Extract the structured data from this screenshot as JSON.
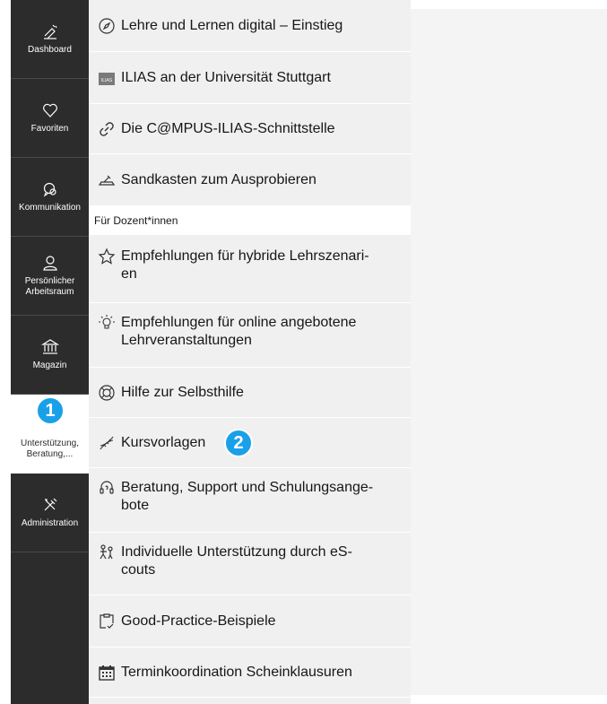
{
  "mainbar": {
    "items": [
      {
        "label": "Dashboard",
        "icon": "dashboard-icon"
      },
      {
        "label": "Favoriten",
        "icon": "heart-icon"
      },
      {
        "label": "Kommunikation",
        "icon": "chat-icon"
      },
      {
        "label": "Persönlicher Arbeitsraum",
        "icon": "person-icon"
      },
      {
        "label": "Magazin",
        "icon": "repository-icon"
      },
      {
        "label": "Unterstützung, Beratung,...",
        "icon": "none"
      },
      {
        "label": "Administration",
        "icon": "tools-icon"
      }
    ]
  },
  "slate": {
    "entries": [
      {
        "label": "Lehre und Lernen digital – Einstieg",
        "icon": "compass-icon"
      },
      {
        "label": "ILIAS an der Universität Stuttgart",
        "icon": "ilias-logo-icon"
      },
      {
        "label": "Die C@MPUS-ILIAS-Schnittstelle",
        "icon": "link-icon"
      },
      {
        "label": "Sandkasten zum Ausprobieren",
        "icon": "sandbox-icon"
      }
    ],
    "section_title": "Für Dozent*innen",
    "section_entries": [
      {
        "label_line1": "Empfehlungen für hybride Lehrszenari-",
        "label_line2": "en",
        "icon": "star-icon"
      },
      {
        "label_line1": "Empfehlungen für online angebotene",
        "label_line2": "Lehrveranstaltungen",
        "icon": "lightbulb-icon"
      },
      {
        "label": "Hilfe zur Selbsthilfe",
        "icon": "lifebuoy-icon"
      },
      {
        "label": "Kursvorlagen",
        "icon": "dna-icon"
      },
      {
        "label_line1": "Beratung, Support und Schulungsange-",
        "label_line2": "bote",
        "icon": "headset-icon"
      },
      {
        "label_line1": "Individuelle Unterstützung durch eS-",
        "label_line2": "couts",
        "icon": "people-icon"
      },
      {
        "label": "Good-Practice-Beispiele",
        "icon": "checklist-icon"
      },
      {
        "label": "Terminkoordination Scheinklausuren",
        "icon": "calendar-icon"
      }
    ]
  },
  "annotations": {
    "badge1": "1",
    "badge2": "2"
  },
  "colors": {
    "mainbar": "#2c2c2c",
    "slate": "#f0f0f0",
    "badge": "#1aa0e8"
  }
}
